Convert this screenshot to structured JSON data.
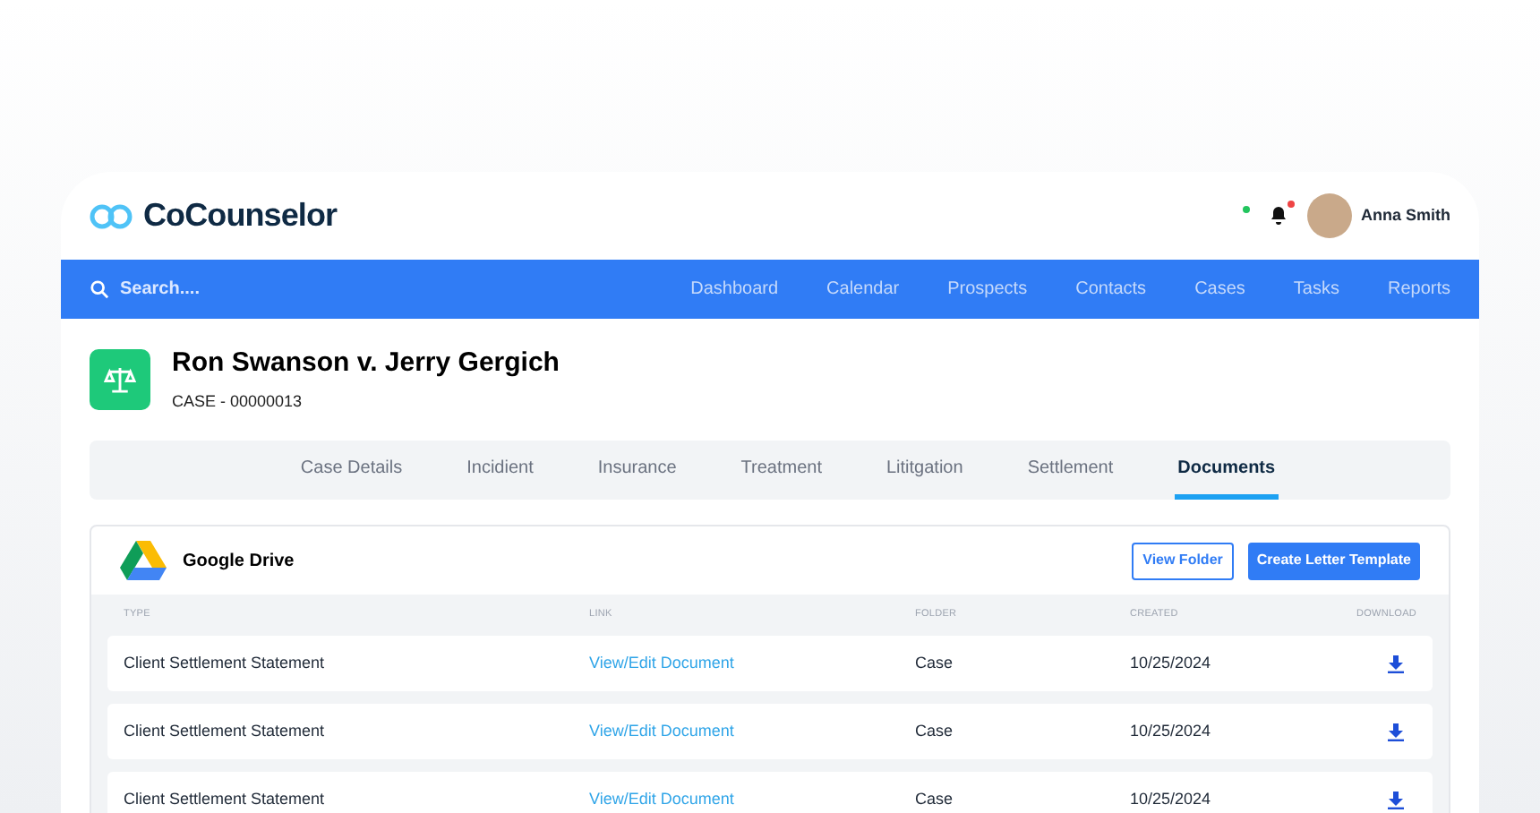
{
  "brand": {
    "name": "CoCounselor"
  },
  "user": {
    "name": "Anna Smith"
  },
  "nav": {
    "search": {
      "placeholder": "Search...."
    },
    "items": [
      {
        "label": "Dashboard",
        "selected": false
      },
      {
        "label": "Calendar",
        "selected": false
      },
      {
        "label": "Prospects",
        "selected": false
      },
      {
        "label": "Contacts",
        "selected": false
      },
      {
        "label": "Cases",
        "selected": false
      },
      {
        "label": "Tasks",
        "selected": false
      },
      {
        "label": "Reports",
        "selected": false
      }
    ]
  },
  "case": {
    "title": "Ron Swanson v. Jerry Gergich",
    "number": "CASE - 00000013"
  },
  "tabs": [
    {
      "label": "Case Details",
      "selected": false
    },
    {
      "label": "Incidient",
      "selected": false
    },
    {
      "label": "Insurance",
      "selected": false
    },
    {
      "label": "Treatment",
      "selected": false
    },
    {
      "label": "Lititgation",
      "selected": false
    },
    {
      "label": "Settlement",
      "selected": false
    },
    {
      "label": "Documents",
      "selected": true
    }
  ],
  "drive": {
    "title": "Google Drive",
    "buttons": [
      {
        "label": "View Folder",
        "kind": "outline"
      },
      {
        "label": "Create Letter Template",
        "kind": "primary"
      }
    ],
    "table": {
      "columns": [
        "TYPE",
        "LINK",
        "FOLDER",
        "CREATED",
        "DOWNLOAD"
      ],
      "rows": [
        {
          "type": "Client Settlement Statement",
          "link": "View/Edit Document",
          "folder": "Case",
          "created": "10/25/2024"
        },
        {
          "type": "Client Settlement Statement",
          "link": "View/Edit Document",
          "folder": "Case",
          "created": "10/25/2024"
        },
        {
          "type": "Client Settlement Statement",
          "link": "View/Edit Document",
          "folder": "Case",
          "created": "10/25/2024"
        }
      ]
    }
  }
}
